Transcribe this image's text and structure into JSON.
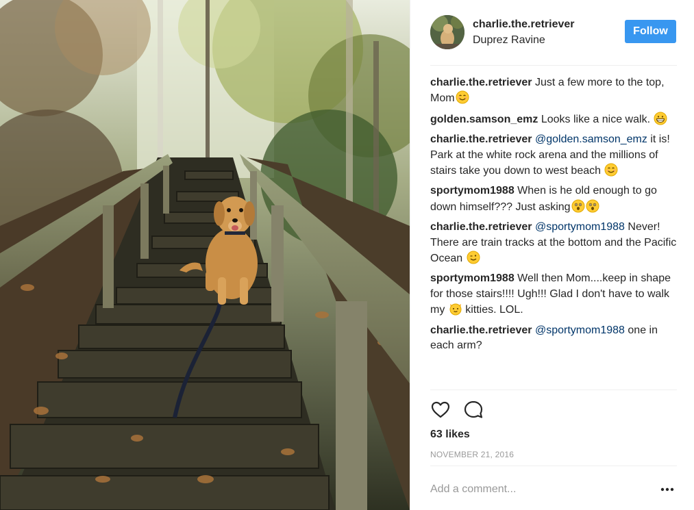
{
  "post": {
    "photo_alt": "Golden retriever on wooden stairs in a forest"
  },
  "header": {
    "username": "charlie.the.retriever",
    "location": "Duprez Ravine",
    "follow_label": "Follow"
  },
  "comments": [
    {
      "user": "charlie.the.retriever",
      "parts": [
        {
          "type": "text",
          "value": " Just a few more to the top, Mom"
        },
        {
          "type": "emoji",
          "icon": "smiling-face-emoji"
        }
      ]
    },
    {
      "user": "golden.samson_emz",
      "parts": [
        {
          "type": "text",
          "value": " Looks like a nice walk. "
        },
        {
          "type": "emoji",
          "icon": "grinning-face-emoji"
        }
      ]
    },
    {
      "user": "charlie.the.retriever",
      "parts": [
        {
          "type": "text",
          "value": " "
        },
        {
          "type": "mention",
          "value": "@golden.samson_emz"
        },
        {
          "type": "text",
          "value": " it is! Park at the white rock arena and the millions of stairs take you down to west beach "
        },
        {
          "type": "emoji",
          "icon": "smiling-face-emoji"
        }
      ]
    },
    {
      "user": "sportymom1988",
      "parts": [
        {
          "type": "text",
          "value": " When is he old enough to go down himself??? Just asking"
        },
        {
          "type": "emoji",
          "icon": "astonished-face-emoji"
        },
        {
          "type": "emoji",
          "icon": "astonished-face-emoji"
        }
      ]
    },
    {
      "user": "charlie.the.retriever",
      "parts": [
        {
          "type": "text",
          "value": " "
        },
        {
          "type": "mention",
          "value": "@sportymom1988"
        },
        {
          "type": "text",
          "value": " Never! There are train tracks at the bottom and the Pacific Ocean "
        },
        {
          "type": "emoji",
          "icon": "winking-face-emoji"
        }
      ]
    },
    {
      "user": "sportymom1988",
      "parts": [
        {
          "type": "text",
          "value": " Well then Mom....keep in shape for those stairs!!!! Ugh!!! Glad I don't have to walk my "
        },
        {
          "type": "emoji",
          "icon": "cat-face-emoji"
        },
        {
          "type": "text",
          "value": " kitties. LOL."
        }
      ]
    },
    {
      "user": "charlie.the.retriever",
      "parts": [
        {
          "type": "text",
          "value": " "
        },
        {
          "type": "mention",
          "value": "@sportymom1988"
        },
        {
          "type": "text",
          "value": " one in each arm?"
        }
      ]
    }
  ],
  "actions": {
    "like_icon": "heart-icon",
    "comment_icon": "comment-bubble-icon"
  },
  "likes_text": "63 likes",
  "date_text": "NOVEMBER 21, 2016",
  "comment_box": {
    "placeholder": "Add a comment...",
    "more_icon": "ellipsis-icon"
  },
  "colors": {
    "follow_button": "#3897f0",
    "mention": "#003569",
    "secondary_text": "#999999",
    "divider": "#efefef"
  }
}
